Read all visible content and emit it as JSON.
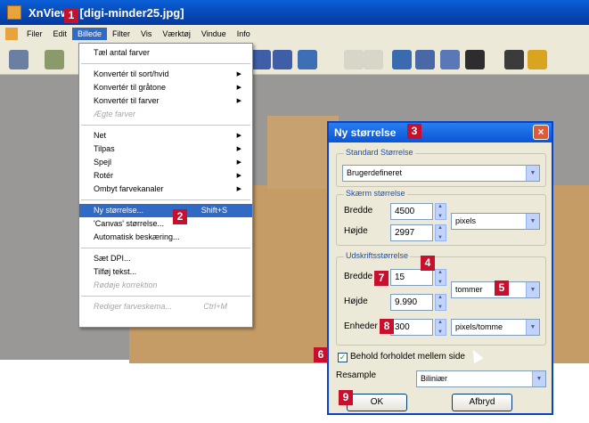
{
  "window": {
    "title": "XnView - [digi-minder25.jpg]"
  },
  "menubar": {
    "items": [
      "Filer",
      "Edit",
      "Billede",
      "Filter",
      "Vis",
      "Værktøj",
      "Vindue",
      "Info"
    ]
  },
  "dropdown": {
    "items": [
      {
        "label": "Tæl antal farver"
      },
      {
        "label": "Konvertér til sort/hvid",
        "submenu": true
      },
      {
        "label": "Konvertér til gråtone",
        "submenu": true
      },
      {
        "label": "Konvertér til farver",
        "submenu": true
      },
      {
        "label": "Ægte farver",
        "disabled": true
      },
      {
        "label": "Net",
        "submenu": true
      },
      {
        "label": "Tilpas",
        "submenu": true
      },
      {
        "label": "Spejl",
        "submenu": true
      },
      {
        "label": "Rotér",
        "submenu": true
      },
      {
        "label": "Ombyt farvekanaler",
        "submenu": true
      },
      {
        "label": "Ny størrelse...",
        "shortcut": "Shift+S",
        "selected": true
      },
      {
        "label": "'Canvas' størrelse..."
      },
      {
        "label": "Automatisk beskæring..."
      },
      {
        "label": "Sæt DPI..."
      },
      {
        "label": "Tilføj tekst..."
      },
      {
        "label": "Rødøje korrektion",
        "disabled": true
      },
      {
        "label": "Rediger farveskema...",
        "shortcut": "Ctrl+M",
        "disabled": true
      }
    ]
  },
  "dialog": {
    "title": "Ny størrelse",
    "close_icon": "×",
    "standard": {
      "label": "Standard Størrelse",
      "value": "Brugerdefineret"
    },
    "screen": {
      "label": "Skærm størrelse",
      "width_label": "Bredde",
      "width_value": "4500",
      "height_label": "Højde",
      "height_value": "2997",
      "unit": "pixels"
    },
    "print": {
      "label": "Udskriftsstørrelse",
      "width_label": "Bredde",
      "width_value": "15",
      "height_label": "Højde",
      "height_value": "9.990",
      "unit": "tommer",
      "units_label": "Enheder",
      "resolution_value": "300",
      "resolution_unit": "pixels/tomme"
    },
    "keep_ratio": {
      "label": "Behold forholdet mellem side",
      "checked": true,
      "mark": "✓"
    },
    "resample": {
      "label": "Resample",
      "value": "Biliniær"
    },
    "ok_label": "OK",
    "cancel_label": "Afbryd"
  },
  "badges": [
    "1",
    "2",
    "3",
    "4",
    "5",
    "6",
    "7",
    "8",
    "9"
  ],
  "icons": {
    "app": "xnview-logo-icon",
    "submenu": "submenu-arrow-icon",
    "dropdown": "dropdown-arrow-icon"
  },
  "colors": {
    "titlebar": "#0a5fd6",
    "badge": "#c8102e",
    "selection": "#316ac5"
  }
}
